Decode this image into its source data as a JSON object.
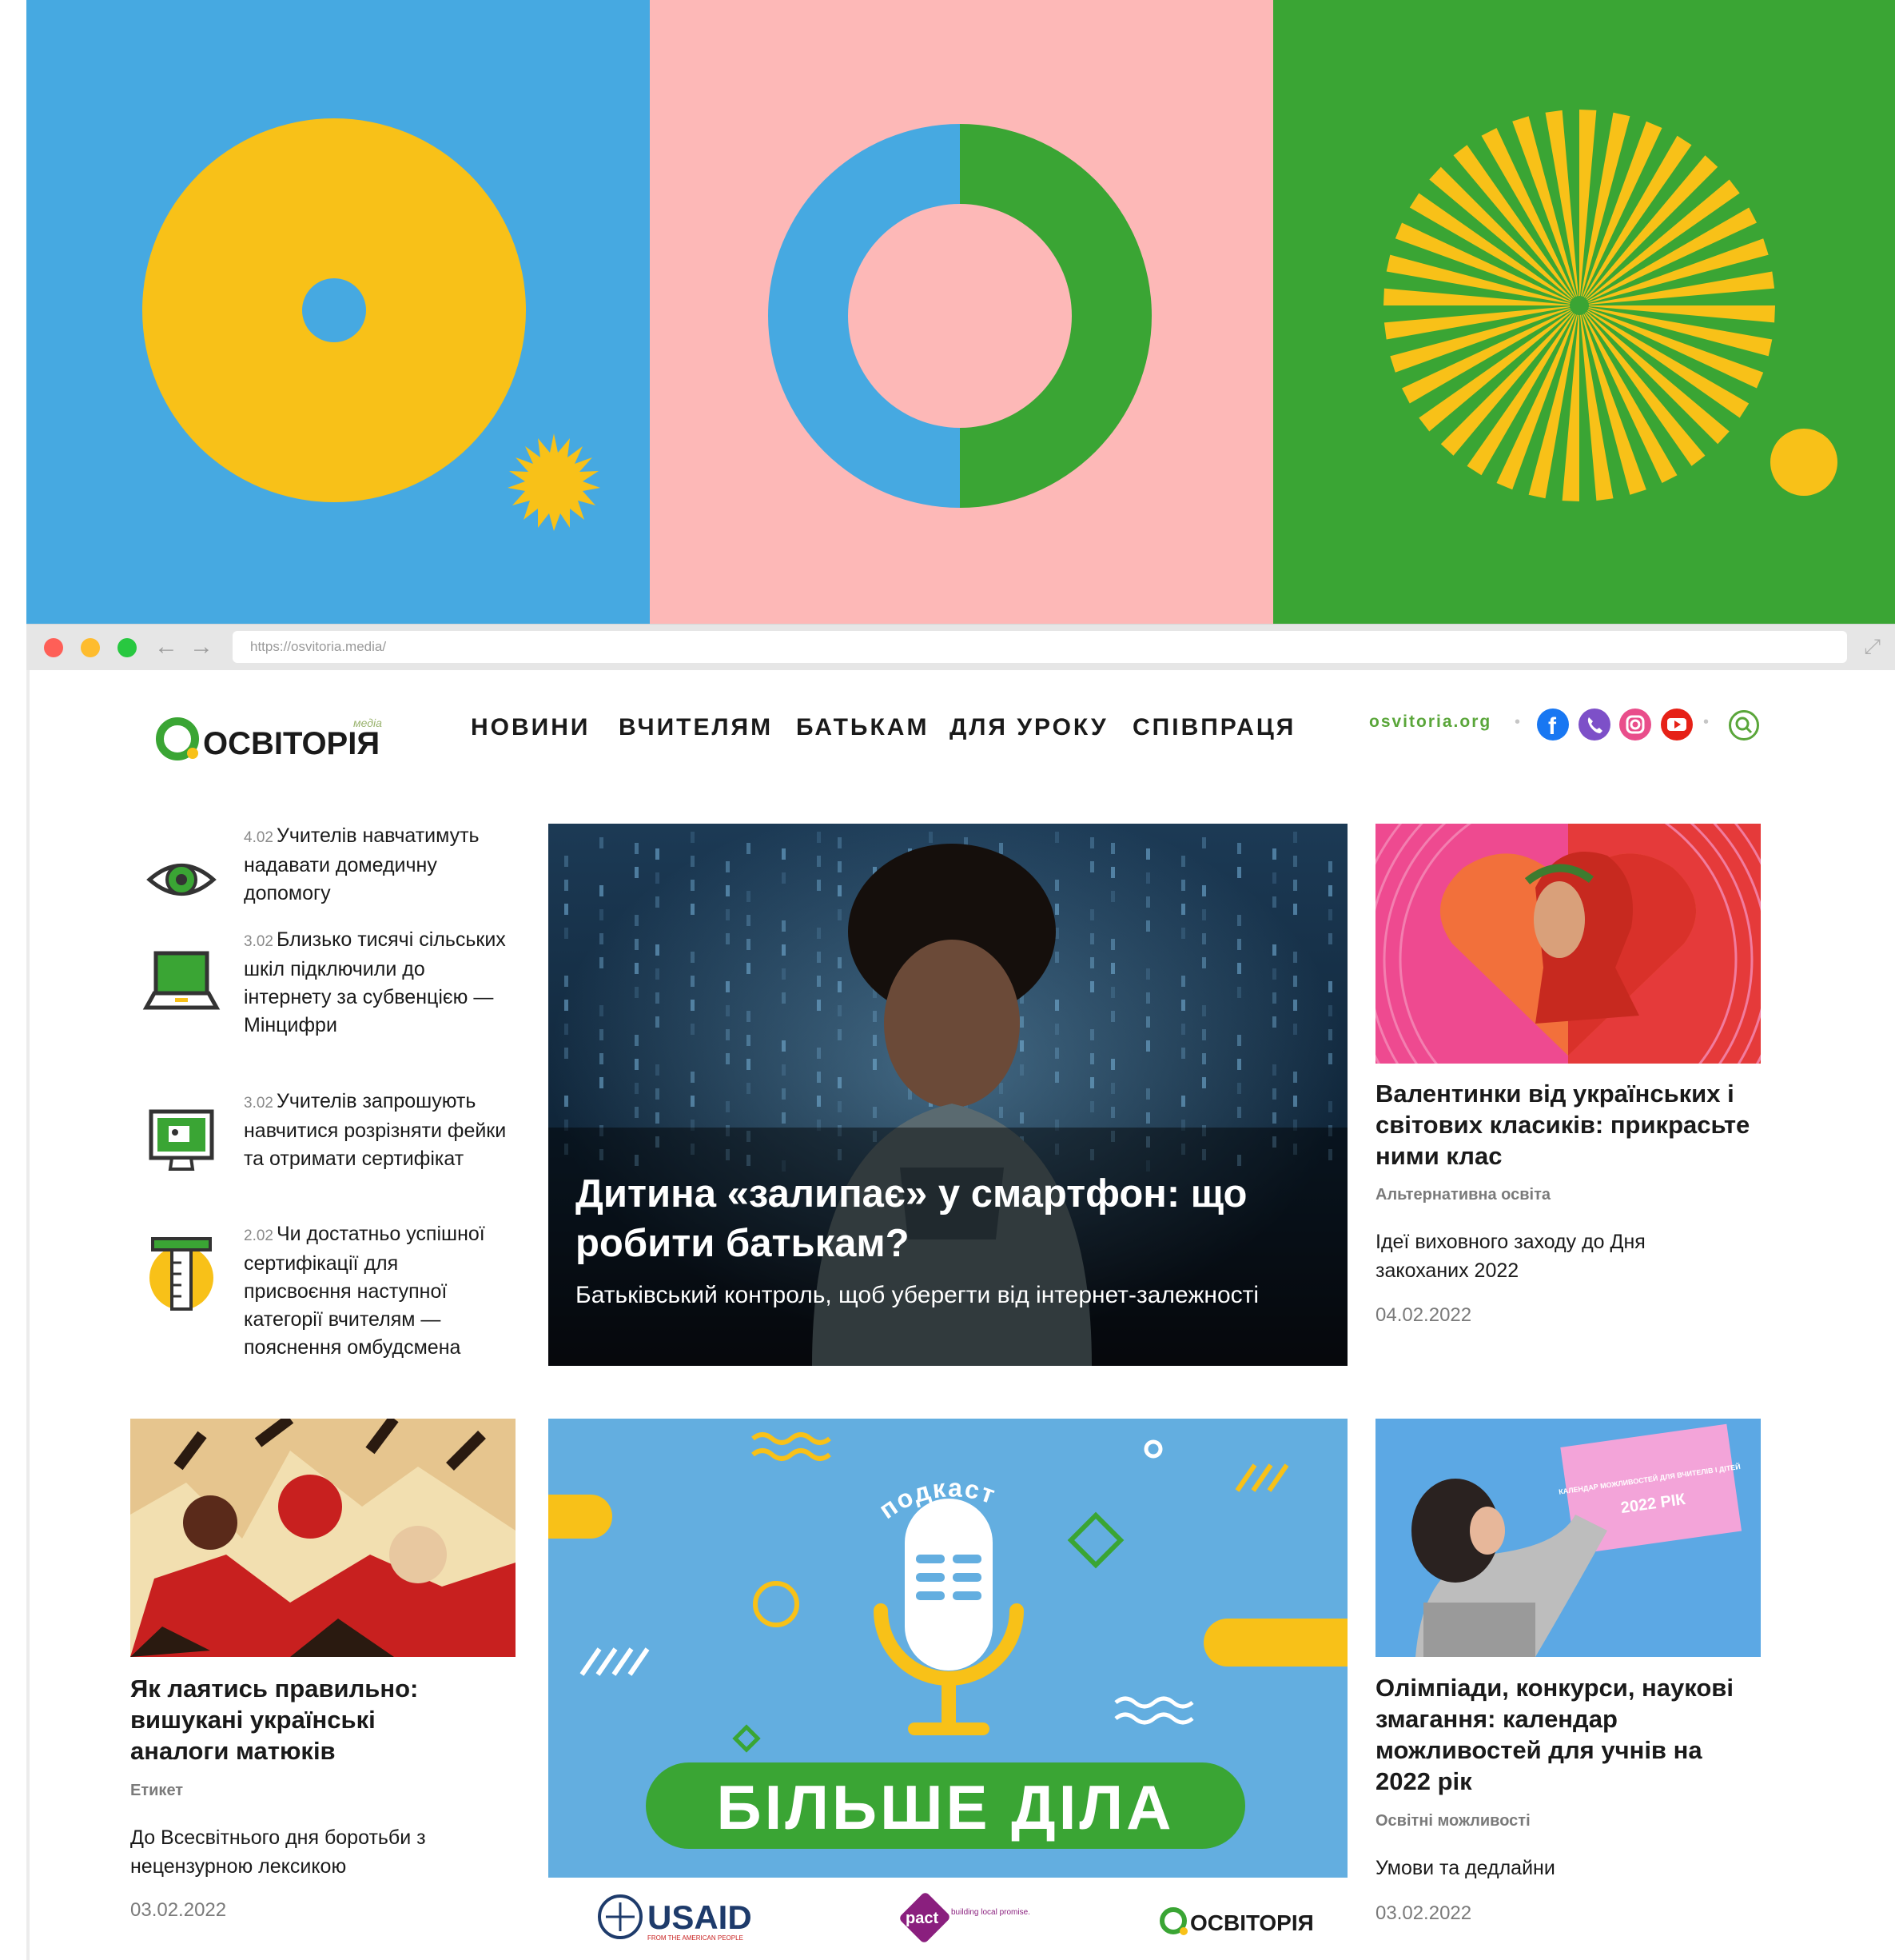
{
  "browser": {
    "url": "https://osvitoria.media/"
  },
  "site": {
    "logo_text": "ОСВІТОРІЯ",
    "logo_superscript": "медіа",
    "nav": [
      "НОВИНИ",
      "ВЧИТЕЛЯМ",
      "БАТЬКАМ",
      "ДЛЯ УРОКУ",
      "СПІВПРАЦЯ"
    ],
    "org_link": "osvitoria.org",
    "social": [
      "facebook-icon",
      "viber-icon",
      "instagram-icon",
      "youtube-icon"
    ],
    "colors": {
      "blue": "#46a9e1",
      "pink": "#fdb8b7",
      "green": "#3aa534",
      "yellow": "#f8c118",
      "facebook": "#1877f2",
      "viber": "#7d50c8",
      "instagram": "#e94e8b",
      "youtube": "#e62117"
    }
  },
  "sidebar_news": [
    {
      "date": "4.02",
      "title": "Учителів навчатимуть надавати домедичну допомогу",
      "icon": "eye-icon"
    },
    {
      "date": "3.02",
      "title": "Близько тисячі сільських шкіл підключили до інтернету за субвенцією — Мінцифри",
      "icon": "laptop-icon"
    },
    {
      "date": "3.02",
      "title": "Учителів запрошують навчитися розрізняти фейки та отримати сертифікат",
      "icon": "monitor-icon"
    },
    {
      "date": "2.02",
      "title": "Чи достатньо успішної сертифікації для присвоєння наступної категорії вчителям — пояснення омбудсмена",
      "icon": "ruler-icon"
    }
  ],
  "hero": {
    "title": "Дитина «залипає» у смартфон: що робити батькам?",
    "subtitle": "Батьківський контроль, щоб уберегти від інтернет-залежності"
  },
  "cards": {
    "valentines": {
      "title": "Валентинки від українських і світових класиків: прикрасьте ними клас",
      "category": "Альтернативна освіта",
      "lead": "Ідеї виховного заходу до Дня закоханих 2022",
      "date": "04.02.2022"
    },
    "swearing": {
      "title": "Як лаятись правильно: вишукані українські аналоги матюків",
      "category": "Етикет",
      "lead": "До Всесвітнього дня боротьби з нецензурною лексикою",
      "date": "03.02.2022"
    },
    "olympiads": {
      "title": "Олімпіади, конкурси, наукові змагання: календар можливостей для учнів на 2022 рік",
      "category": "Освітні можливості",
      "lead": "Умови та дедлайни",
      "date": "03.02.2022",
      "calendar_text": "КАЛЕНДАР МОЖЛИВОСТЕЙ ДЛЯ ВЧИТЕЛІВ І ДІТЕЙ",
      "calendar_year": "2022 РІК"
    }
  },
  "podcast": {
    "arc_label": "подкаст",
    "title": "БІЛЬШЕ ДІЛА",
    "sponsors": [
      "USAID",
      "pact",
      "ОСВІТОРІЯ"
    ],
    "usaid_sub": "FROM THE AMERICAN PEOPLE",
    "pact_tagline": "building local promise."
  }
}
